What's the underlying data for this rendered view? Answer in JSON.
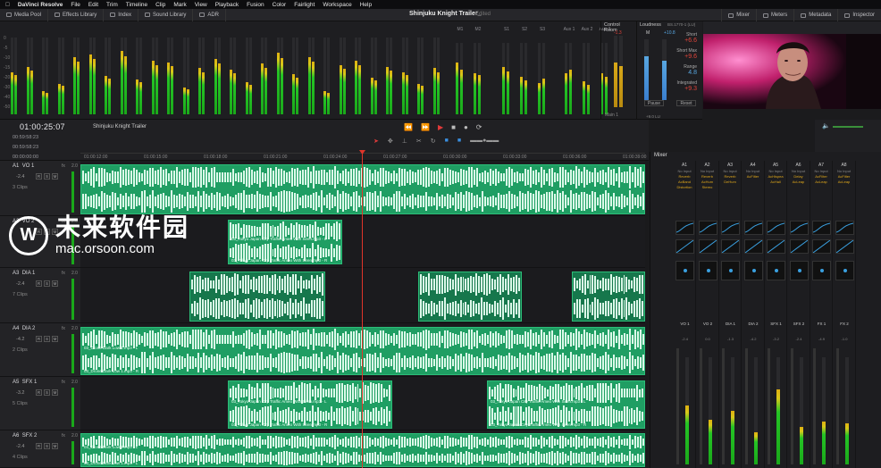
{
  "menubar": {
    "app": "DaVinci Resolve",
    "items": [
      "File",
      "Edit",
      "Trim",
      "Timeline",
      "Clip",
      "Mark",
      "View",
      "Playback",
      "Fusion",
      "Color",
      "Fairlight",
      "Workspace",
      "Help"
    ]
  },
  "toolbar": {
    "media_pool": "Media Pool",
    "effects_library": "Effects Library",
    "index": "Index",
    "sound_library": "Sound Library",
    "adr": "ADR",
    "project_title": "Shinjuku Knight Trailer_",
    "edited": "Edited",
    "mixer": "Mixer",
    "meters": "Meters",
    "metadata": "Metadata",
    "inspector": "Inspector"
  },
  "meters": {
    "bus_labels": [
      "M1",
      "M2",
      "S1",
      "S2",
      "S3",
      "Aux 1",
      "Aux 2",
      "Aux 3"
    ],
    "scale": [
      "0",
      "-5",
      "-10",
      "-15",
      "-20",
      "-30",
      "-40",
      "-50"
    ],
    "levels": [
      0.55,
      0.62,
      0.3,
      0.4,
      0.75,
      0.78,
      0.5,
      0.82,
      0.45,
      0.7,
      0.68,
      0.35,
      0.6,
      0.72,
      0.58,
      0.42,
      0.66,
      0.8,
      0.52,
      0.74,
      0.3,
      0.64,
      0.7,
      0.48,
      0.62,
      0.55,
      0.4,
      0.6
    ],
    "bus_levels": [
      0.72,
      0.62,
      0.58,
      0.55,
      0.66,
      0.6,
      0.52,
      0.48,
      0.44,
      0.5,
      0.57,
      0.63,
      0.46,
      0.41,
      0.58,
      0.52
    ]
  },
  "control_room": {
    "title": "Control Room",
    "value": "-1.3",
    "level_left": 0.62,
    "level_right": 0.58,
    "select": "Main 1"
  },
  "loudness": {
    "title": "Loudness",
    "standard": "BS.1770-1 (LU)",
    "m_label": "M",
    "m_value": "+10.8",
    "level_left": 0.72,
    "level_right": 0.64,
    "short_label": "Short",
    "short_value": "+6.6",
    "short_max_label": "Short Max",
    "short_max_value": "+9.6",
    "range_label": "Range",
    "range_value": "4.8",
    "integrated_label": "Integrated",
    "integrated_value": "+9.3",
    "pause": "Pause",
    "reset": "Reset",
    "unit_select": "+9.0 LU"
  },
  "timeline": {
    "timecode": "01:00:25:07",
    "name": "Shinjuku Knight Trailer",
    "tc1": "00:59:58:23",
    "tc2": "00:59:58:23",
    "tc3": "00:00:00:00",
    "ruler": [
      "01:00:12:00",
      "01:00:15:00",
      "01:00:18:00",
      "01:00:21:00",
      "01:00:24:00",
      "01:00:27:00",
      "01:00:30:00",
      "01:00:33:00",
      "01:00:36:00",
      "01:00:39:00"
    ]
  },
  "tracks": [
    {
      "id": "A1",
      "name": "VO 1",
      "gain": "-2.4",
      "clips": "3 Clips",
      "vol": "2.0"
    },
    {
      "id": "A2",
      "name": "VO 2",
      "gain": "",
      "clips": "",
      "vol": "2.0"
    },
    {
      "id": "A3",
      "name": "DIA 1",
      "gain": "-2.4",
      "clips": "7 Clips",
      "vol": "2.0"
    },
    {
      "id": "A4",
      "name": "DIA 2",
      "gain": "-4.2",
      "clips": "2 Clips",
      "vol": "2.0"
    },
    {
      "id": "A5",
      "name": "SFX 1",
      "gain": "-3.2",
      "clips": "5 Clips",
      "vol": "2.0"
    },
    {
      "id": "A6",
      "name": "SFX 2",
      "gain": "-2.4",
      "clips": "4 Clips",
      "vol": "2.0"
    }
  ],
  "clip_labels": {
    "traffic": "03_Tokyo Japan City Traffic Ameo With Siren.mp3 - L",
    "traffic_r": "03_Tokyo Japan City Traffic Ameo With Siren.mp3 - R",
    "drone": "03_Drone Dark Low 1.mp3 - L",
    "drone_r": "03_Drone Dark Low 1.mp3 - R"
  },
  "mixer": {
    "title": "Mixer",
    "channels": [
      {
        "id": "A1",
        "name": "VO 1",
        "plug1": "Reverb",
        "plug2": "AcBand",
        "plug3": "Distortion",
        "level": 0.55,
        "gain": "-2.4"
      },
      {
        "id": "A2",
        "name": "VO 2",
        "plug1": "Reverb",
        "plug2": "AcHum",
        "plug3": "Stereo",
        "level": 0.42,
        "gain": "0.0"
      },
      {
        "id": "A3",
        "name": "DIA 1",
        "plug1": "Reverb",
        "plug2": "DeHum",
        "plug3": "",
        "level": 0.5,
        "gain": "-1.3"
      },
      {
        "id": "A4",
        "name": "DIA 2",
        "plug1": "AcFilter",
        "plug2": "",
        "plug3": "",
        "level": 0.3,
        "gain": "-4.2"
      },
      {
        "id": "A5",
        "name": "SFX 1",
        "plug1": "AcHispea",
        "plug2": "AcHall",
        "plug3": "",
        "level": 0.7,
        "gain": "-3.2"
      },
      {
        "id": "A6",
        "name": "SFX 2",
        "plug1": "Delay",
        "plug2": "AcLeap",
        "plug3": "",
        "level": 0.35,
        "gain": "-2.4"
      },
      {
        "id": "A7",
        "name": "FX 1",
        "plug1": "AcFilter",
        "plug2": "AcLeap",
        "plug3": "",
        "level": 0.4,
        "gain": "-4.9"
      },
      {
        "id": "A8",
        "name": "FX 2",
        "plug1": "AcFilter",
        "plug2": "AcLeap",
        "plug3": "",
        "level": 0.38,
        "gain": "-1.0"
      }
    ],
    "input": "No Input"
  },
  "watermark": {
    "cn": "未来软件园",
    "url": "mac.orsoon.com"
  },
  "colors": {
    "clip_green": "#1f9e63",
    "playhead": "#e0352a",
    "meter_green": "#1aa81a",
    "meter_yellow": "#d8c81a"
  }
}
